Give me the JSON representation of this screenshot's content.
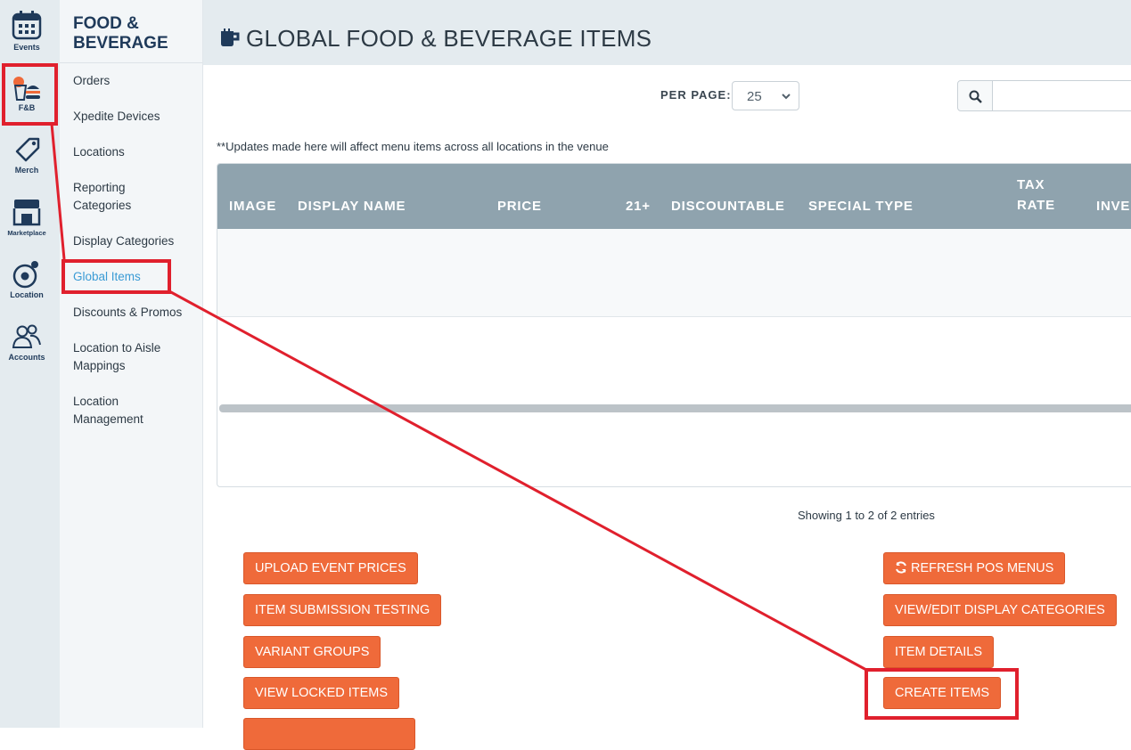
{
  "rail": {
    "items": [
      {
        "label": "Events",
        "icon": "calendar-icon"
      },
      {
        "label": "F&B",
        "icon": "food-beverage-icon"
      },
      {
        "label": "Merch",
        "icon": "tag-icon"
      },
      {
        "label": "Marketplace",
        "icon": "storefront-icon"
      },
      {
        "label": "Location",
        "icon": "location-target-icon"
      },
      {
        "label": "Accounts",
        "icon": "users-icon"
      }
    ]
  },
  "subnav": {
    "title_line1": "FOOD &",
    "title_line2": "BEVERAGE",
    "items": [
      {
        "line1": "Orders",
        "line2": ""
      },
      {
        "line1": "Xpedite Devices",
        "line2": ""
      },
      {
        "line1": "Locations",
        "line2": ""
      },
      {
        "line1": "Reporting",
        "line2": "Categories"
      },
      {
        "line1": "Display Categories",
        "line2": ""
      },
      {
        "line1": "Global Items",
        "line2": ""
      },
      {
        "line1": "Discounts & Promos",
        "line2": ""
      },
      {
        "line1": "Location to Aisle",
        "line2": "Mappings"
      },
      {
        "line1": "Location",
        "line2": "Management"
      }
    ],
    "active_index": 5
  },
  "header": {
    "title": "GLOBAL FOOD & BEVERAGE ITEMS",
    "icon": "cup-icon"
  },
  "controls": {
    "per_page_label": "PER PAGE:",
    "per_page_value": "25",
    "search_icon": "search-icon",
    "search_value": ""
  },
  "note": "**Updates made here will affect menu items across all locations in the venue",
  "table": {
    "columns": [
      "IMAGE",
      "DISPLAY NAME",
      "PRICE",
      "21+",
      "DISCOUNTABLE",
      "SPECIAL TYPE",
      "TAX",
      "RATE",
      "INVE"
    ],
    "rows": [],
    "footer": "Showing 1 to 2 of 2 entries"
  },
  "buttons_left": [
    "UPLOAD EVENT PRICES",
    "ITEM SUBMISSION TESTING",
    "VARIANT GROUPS",
    "VIEW LOCKED ITEMS"
  ],
  "buttons_right": [
    "REFRESH POS MENUS",
    "VIEW/EDIT DISPLAY CATEGORIES",
    "ITEM DETAILS",
    "CREATE ITEMS"
  ],
  "colors": {
    "accent_orange": "#ef6a3a",
    "annotation_red": "#e0202d",
    "table_header": "#8fa3ae",
    "active_link": "#3a9bd5",
    "brand_navy": "#1f3a5a"
  }
}
